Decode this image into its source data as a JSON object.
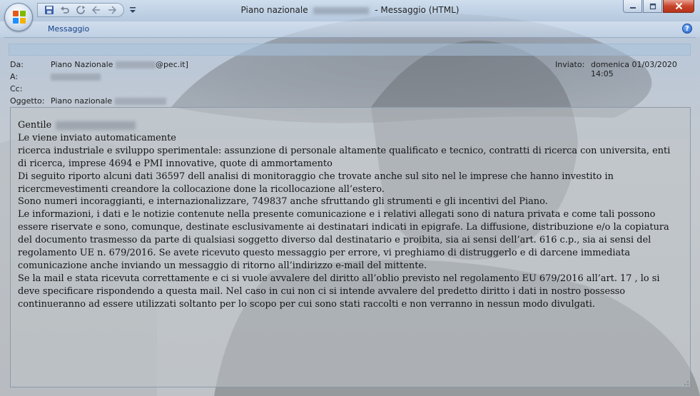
{
  "window": {
    "title_prefix": "Piano nazionale",
    "title_suffix": "- Messaggio (HTML)"
  },
  "ribbon": {
    "tab_label": "Messaggio",
    "help_glyph": "?"
  },
  "header": {
    "from_label": "Da:",
    "from_name": "Piano Nazionale",
    "from_domain": "@pec.it]",
    "to_label": "A:",
    "cc_label": "Cc:",
    "subject_label": "Oggetto:",
    "subject_value": "Piano nazionale",
    "sent_label": "Inviato:",
    "sent_value": "domenica 01/03/2020 14:05"
  },
  "body": {
    "greeting": "Gentile",
    "paragraphs": [
      "Le viene inviato automaticamente",
      "ricerca industriale e sviluppo sperimentale: assunzione di personale altamente qualificato e tecnico, contratti di ricerca con universita, enti di ricerca, imprese 4694 e PMI innovative, quote di ammortamento",
      "Di seguito riporto alcuni dati 36597 dell analisi di monitoraggio che trovate anche sul sito nel le imprese che hanno investito in ricercmevestimenti creandore la collocazione done la ricollocazione all’estero.",
      "Sono numeri incoraggianti, e internazionalizzare, 749837 anche sfruttando gli strumenti e gli incentivi del Piano.",
      "Le informazioni, i dati e le notizie contenute nella presente comunicazione e i relativi allegati sono di natura privata e come tali possono essere riservate e sono, comunque, destinate esclusivamente ai destinatari indicati in epigrafe. La diffusione, distribuzione e/o la copiatura del documento trasmesso da parte di qualsiasi soggetto diverso dal destinatario e proibita, sia ai sensi dell’art. 616 c.p., sia ai sensi del regolamento UE n. 679/2016. Se avete ricevuto questo messaggio per errore, vi preghiamo di distruggerlo e di darcene immediata comunicazione anche inviando un messaggio di ritorno all’indirizzo e-mail del mittente.",
      "Se la mail e stata ricevuta correttamente e ci si vuole avvalere del diritto all’oblio previsto nel regolamento EU 679/2016 all’art. 17 , lo si deve specificare rispondendo a questa mail. Nel caso in cui non ci si intende avvalere del predetto diritto i dati in nostro possesso continueranno ad essere utilizzati soltanto per lo scopo per cui sono stati raccolti e non verranno in nessun modo divulgati."
    ]
  },
  "icons": {
    "office_button": "office-logo-icon",
    "save": "save-icon",
    "undo": "undo-icon",
    "redo": "redo-icon",
    "previous": "previous-item-icon",
    "next": "next-item-icon",
    "customize": "customize-toolbar-icon",
    "minimize": "minimize-icon",
    "maximize": "maximize-icon",
    "close": "close-icon",
    "help": "help-icon"
  },
  "colors": {
    "accent": "#15428b",
    "close_button": "#c8452c"
  }
}
